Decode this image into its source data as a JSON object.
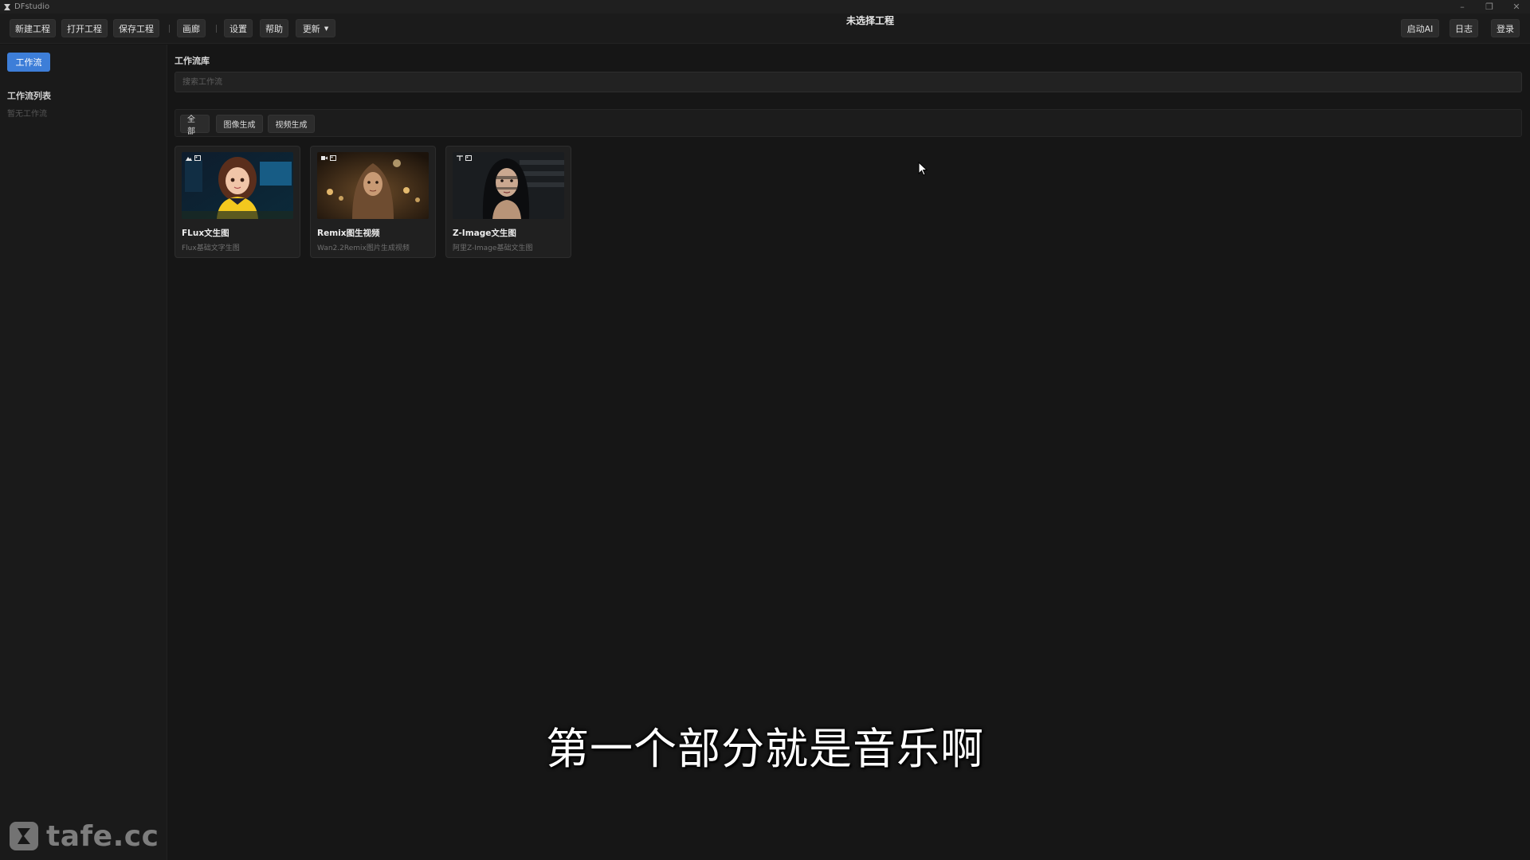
{
  "window": {
    "title": "DFstudio",
    "controls": [
      "–",
      "❐",
      "✕"
    ]
  },
  "toolbar": {
    "new_project": "新建工程",
    "open_project": "打开工程",
    "save_project": "保存工程",
    "gallery": "画廊",
    "settings": "设置",
    "help": "帮助",
    "update": "更新",
    "project_title": "未选择工程",
    "start_ai": "启动AI",
    "logs": "日志",
    "login": "登录"
  },
  "sidebar": {
    "tab_workflow": "工作流",
    "heading": "工作流列表",
    "empty_text": "暂无工作流"
  },
  "main": {
    "heading": "工作流库",
    "search_placeholder": "搜索工作流",
    "search_value": "",
    "filters": [
      {
        "label": "全部"
      },
      {
        "label": "图像生成"
      },
      {
        "label": "视频生成"
      }
    ],
    "cards": [
      {
        "title": "FLux文生图",
        "desc": "Flux基础文字生图",
        "thumb_icon": "cartoon-girl-yellow"
      },
      {
        "title": "Remix图生视频",
        "desc": "Wan2.2Remix图片生成视频",
        "thumb_icon": "woman-headscarf-candles"
      },
      {
        "title": "Z-Image文生图",
        "desc": "阿里Z-Image基础文生图",
        "thumb_icon": "woman-shadow-portrait"
      }
    ]
  },
  "overlay": {
    "subtitle": "第一个部分就是音乐啊",
    "watermark": "tafe.cc"
  },
  "colors": {
    "accent": "#3d7ed8",
    "background": "#161616",
    "panel": "#1a1a1a"
  }
}
